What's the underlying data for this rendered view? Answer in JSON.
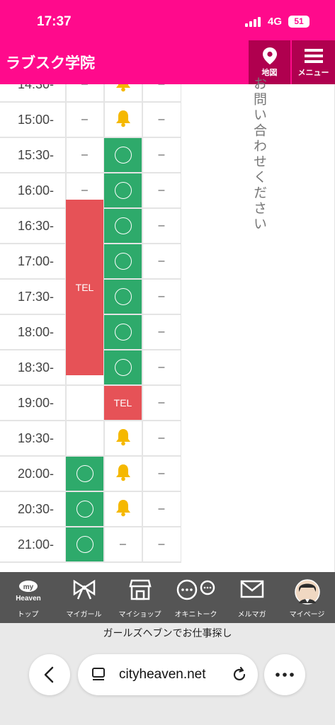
{
  "status": {
    "time": "17:37",
    "network": "4G",
    "battery": "51"
  },
  "header": {
    "title": "ラブスク学院",
    "map_label": "地図",
    "menu_label": "メニュー"
  },
  "schedule": {
    "rows": [
      {
        "time": "14:30-",
        "c1": "–",
        "c2": "bell",
        "c3": "–"
      },
      {
        "time": "15:00-",
        "c1": "–",
        "c2": "bell",
        "c3": "–"
      },
      {
        "time": "15:30-",
        "c1": "–",
        "c2": "circle",
        "c3": "–"
      },
      {
        "time": "16:00-",
        "c1": "–",
        "c2": "circle",
        "c3": "–"
      },
      {
        "time": "16:30-",
        "c1": "–",
        "c2": "circle",
        "c3": "–"
      },
      {
        "time": "17:00-",
        "c1": "–",
        "c2": "circle",
        "c3": "–"
      },
      {
        "time": "17:30-",
        "c1": "tel",
        "c2": "circle",
        "c3": "–"
      },
      {
        "time": "18:00-",
        "c1": "tel",
        "c2": "circle",
        "c3": "–"
      },
      {
        "time": "18:30-",
        "c1": "tel",
        "c2": "circle",
        "c3": "–"
      },
      {
        "time": "19:00-",
        "c1": "tel",
        "c2": "TEL",
        "c3": "–"
      },
      {
        "time": "19:30-",
        "c1": "tel",
        "c2": "bell",
        "c3": "–"
      },
      {
        "time": "20:00-",
        "c1": "circle",
        "c2": "bell",
        "c3": "–"
      },
      {
        "time": "20:30-",
        "c1": "circle",
        "c2": "bell",
        "c3": "–"
      },
      {
        "time": "21:00-",
        "c1": "circle",
        "c2": "–",
        "c3": "–"
      }
    ],
    "tel_block_label": "TEL",
    "side_note": "お問い合わせください"
  },
  "tabbar": {
    "items": [
      {
        "label": "トップ",
        "icon": "my-heaven-icon"
      },
      {
        "label": "マイガール",
        "icon": "ribbon-icon"
      },
      {
        "label": "マイショップ",
        "icon": "shop-icon"
      },
      {
        "label": "オキニトーク",
        "icon": "chat-icon"
      },
      {
        "label": "メルマガ",
        "icon": "mail-icon"
      },
      {
        "label": "マイページ",
        "icon": "avatar-icon"
      }
    ]
  },
  "browser": {
    "banner": "ガールズヘブンでお仕事探し",
    "url": "cityheaven.net"
  },
  "colors": {
    "brand": "#ff0a8c",
    "green": "#2eaa6b",
    "red": "#e65257",
    "bell": "#f5b800"
  }
}
